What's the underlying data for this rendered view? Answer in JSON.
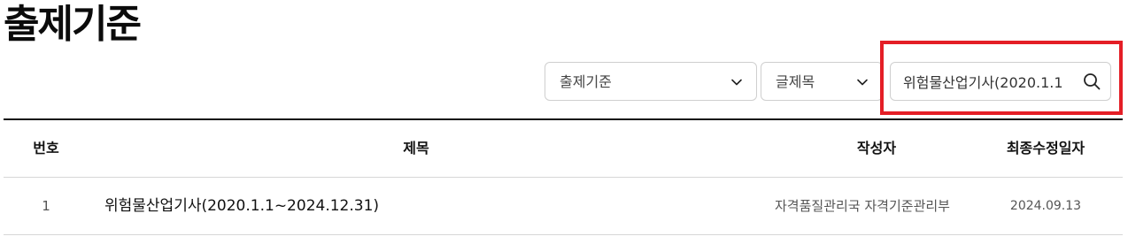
{
  "page": {
    "title": "출제기준"
  },
  "search": {
    "category_select": {
      "selected": "출제기준",
      "icon": "chevron-down-icon"
    },
    "field_select": {
      "selected": "글제목",
      "icon": "chevron-down-icon"
    },
    "keyword_input": {
      "value": "위험물산업기사(2020.1.1"
    },
    "search_button_icon": "search-icon"
  },
  "highlight": {
    "color": "#e41e26"
  },
  "table": {
    "columns": [
      "번호",
      "제목",
      "작성자",
      "최종수정일자"
    ],
    "rows": [
      {
        "no": "1",
        "title": "위험물산업기사(2020.1.1~2024.12.31)",
        "author": "자격품질관리국 자격기준관리부",
        "date": "2024.09.13"
      }
    ]
  }
}
